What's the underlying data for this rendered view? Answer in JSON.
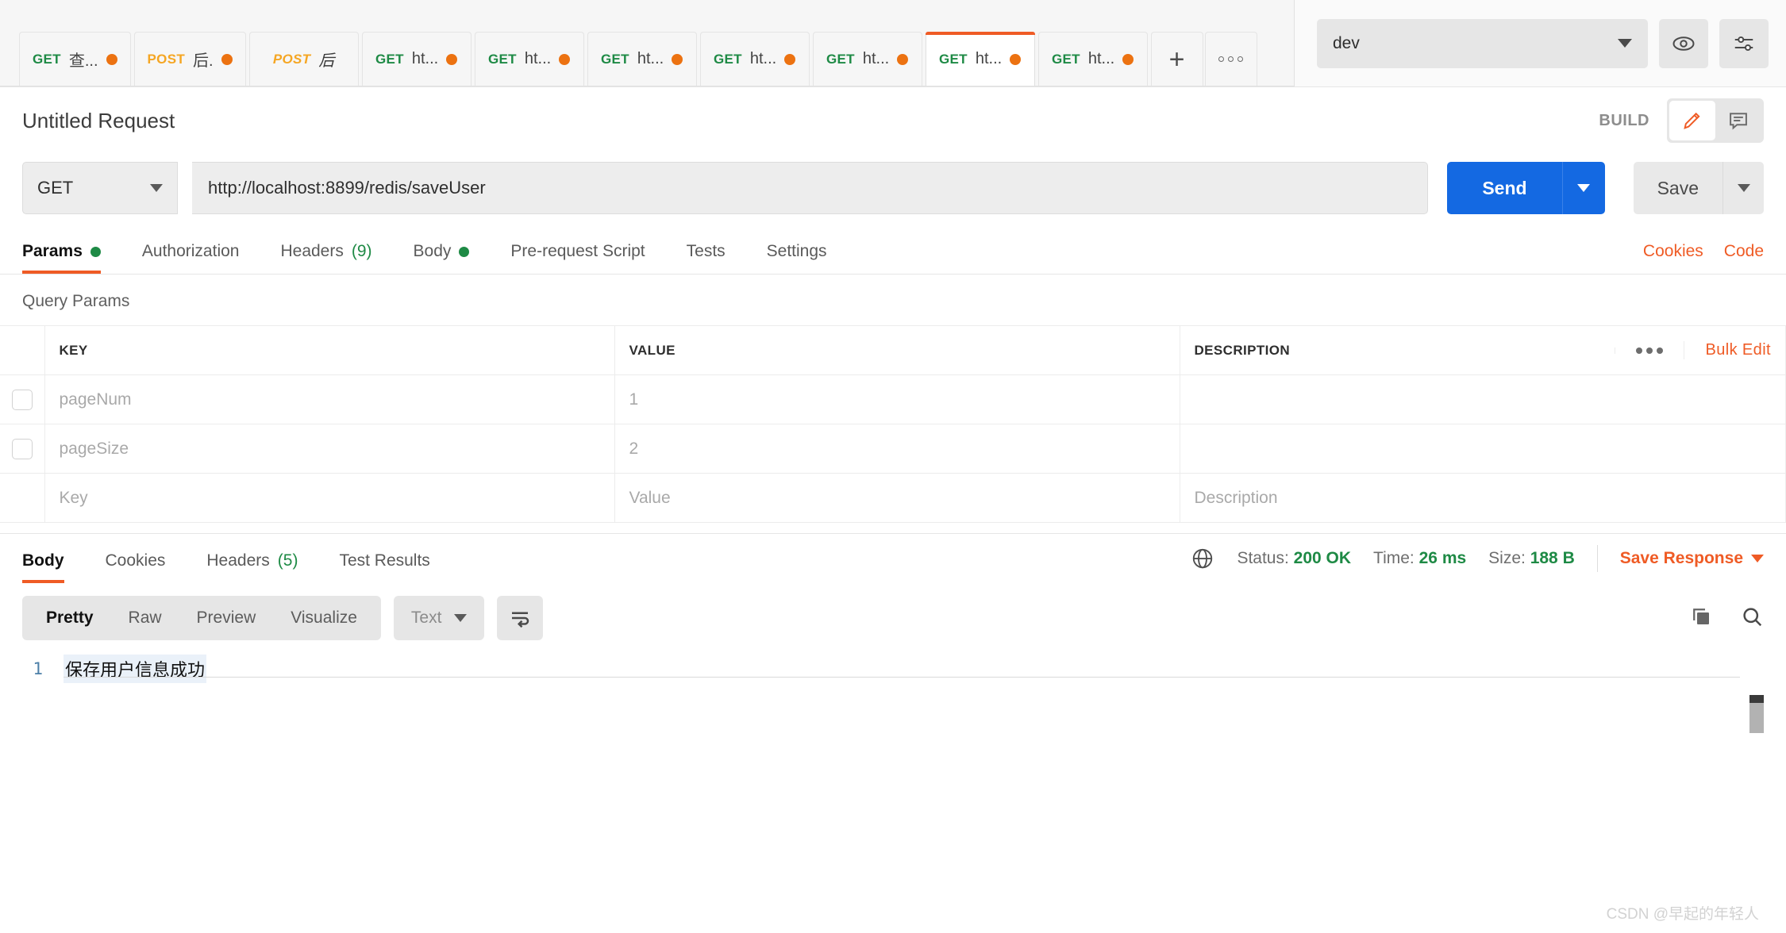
{
  "tabs": [
    {
      "method": "GET",
      "name": "查...",
      "unsaved": true,
      "active": false,
      "italic": false
    },
    {
      "method": "POST",
      "name": "后.",
      "unsaved": true,
      "active": false,
      "italic": false
    },
    {
      "method": "POST",
      "name": "后",
      "unsaved": false,
      "active": false,
      "italic": true
    },
    {
      "method": "GET",
      "name": "ht...",
      "unsaved": true,
      "active": false,
      "italic": false
    },
    {
      "method": "GET",
      "name": "ht...",
      "unsaved": true,
      "active": false,
      "italic": false
    },
    {
      "method": "GET",
      "name": "ht...",
      "unsaved": true,
      "active": false,
      "italic": false
    },
    {
      "method": "GET",
      "name": "ht...",
      "unsaved": true,
      "active": false,
      "italic": false
    },
    {
      "method": "GET",
      "name": "ht...",
      "unsaved": true,
      "active": false,
      "italic": false
    },
    {
      "method": "GET",
      "name": "ht...",
      "unsaved": true,
      "active": true,
      "italic": false
    },
    {
      "method": "GET",
      "name": "ht...",
      "unsaved": true,
      "active": false,
      "italic": false
    }
  ],
  "tabbar": {
    "new_tab_label": "+",
    "more_label": "●●●"
  },
  "environment": {
    "selected": "dev",
    "eye_icon": "eye-icon",
    "settings_icon": "sliders-icon"
  },
  "request_header": {
    "title": "Untitled Request",
    "build_label": "BUILD",
    "edit_icon": "pencil-icon",
    "comment_icon": "comment-icon"
  },
  "url_bar": {
    "method": "GET",
    "url": "http://localhost:8899/redis/saveUser",
    "send_label": "Send",
    "save_label": "Save"
  },
  "request_tabs": [
    {
      "label": "Params",
      "dot": true,
      "count": "",
      "active": true
    },
    {
      "label": "Authorization",
      "dot": false,
      "count": "",
      "active": false
    },
    {
      "label": "Headers",
      "dot": false,
      "count": "(9)",
      "active": false
    },
    {
      "label": "Body",
      "dot": true,
      "count": "",
      "active": false
    },
    {
      "label": "Pre-request Script",
      "dot": false,
      "count": "",
      "active": false
    },
    {
      "label": "Tests",
      "dot": false,
      "count": "",
      "active": false
    },
    {
      "label": "Settings",
      "dot": false,
      "count": "",
      "active": false
    }
  ],
  "request_tabs_right": [
    {
      "label": "Cookies"
    },
    {
      "label": "Code"
    }
  ],
  "query_params": {
    "section_title": "Query Params",
    "columns": [
      "KEY",
      "VALUE",
      "DESCRIPTION"
    ],
    "bulk_edit_label": "Bulk Edit",
    "rows": [
      {
        "key": "pageNum",
        "value": "1",
        "description": "",
        "checked": false,
        "placeholder": false
      },
      {
        "key": "pageSize",
        "value": "2",
        "description": "",
        "checked": false,
        "placeholder": false
      },
      {
        "key": "Key",
        "value": "Value",
        "description": "Description",
        "checked": false,
        "placeholder": true
      }
    ]
  },
  "response": {
    "tabs": [
      {
        "label": "Body",
        "count": "",
        "active": true
      },
      {
        "label": "Cookies",
        "count": "",
        "active": false
      },
      {
        "label": "Headers",
        "count": "(5)",
        "active": false
      },
      {
        "label": "Test Results",
        "count": "",
        "active": false
      }
    ],
    "globe_icon": "globe-icon",
    "status_label": "Status:",
    "status_value": "200 OK",
    "time_label": "Time:",
    "time_value": "26 ms",
    "size_label": "Size:",
    "size_value": "188 B",
    "save_response_label": "Save Response",
    "view_modes": [
      {
        "label": "Pretty",
        "active": true
      },
      {
        "label": "Raw",
        "active": false
      },
      {
        "label": "Preview",
        "active": false
      },
      {
        "label": "Visualize",
        "active": false
      }
    ],
    "format": "Text",
    "wrap_icon": "word-wrap-icon",
    "copy_icon": "copy-icon",
    "search_icon": "search-icon",
    "body_lines": [
      {
        "number": "1",
        "text": "保存用户信息成功"
      }
    ]
  },
  "watermark": "CSDN @早起的年轻人",
  "colors": {
    "accent_orange": "#ef5b25",
    "send_blue": "#1469e2",
    "green": "#1e8a45",
    "post_orange": "#f5a623",
    "unsaved_dot": "#ec7211"
  }
}
